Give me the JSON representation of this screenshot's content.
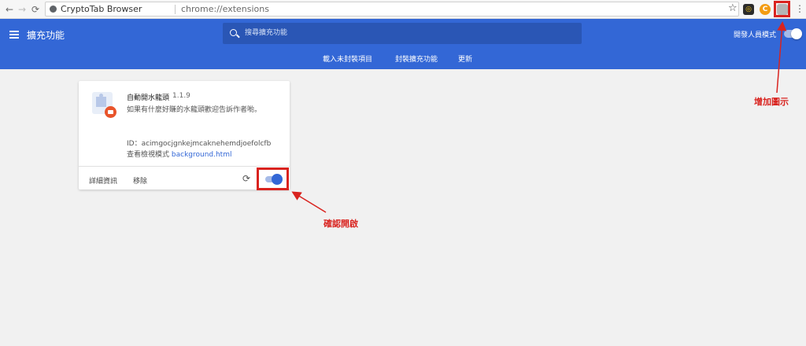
{
  "browser": {
    "site_name": "CryptoTab Browser",
    "url": "chrome://extensions",
    "back_glyph": "←",
    "forward_glyph": "→",
    "reload_glyph": "⟳",
    "star_glyph": "☆",
    "more_glyph": "⋮",
    "toolbar_icons": [
      {
        "name": "crypto-extension-icon",
        "glyph": "◎",
        "color": "#2b2b2b"
      },
      {
        "name": "cryptotab-icon",
        "glyph": "C",
        "color": "#f39c12"
      },
      {
        "name": "new-extension-icon",
        "glyph": "",
        "color": "#b5b5b5"
      }
    ]
  },
  "header": {
    "title": "擴充功能",
    "search_placeholder": "搜尋擴充功能",
    "dev_mode_label": "開發人員模式",
    "accent": "#3367d6",
    "tabs": [
      "載入未封裝項目",
      "封裝擴充功能",
      "更新"
    ]
  },
  "extension": {
    "name": "自動開水龍頭",
    "version": "1.1.9",
    "description": "如果有什麼好賺的水龍頭歡迎告訴作者喲。",
    "id_text": "ID：acimgocjgnkejmcaknehemdjoefolcfb",
    "inspect_label": "查看檢視模式",
    "inspect_link": "background.html",
    "details_label": "詳細資訊",
    "remove_label": "移除",
    "reload_glyph": "⟳",
    "enabled": true
  },
  "annotations": {
    "add_icon_note": "增加圖示",
    "confirm_enabled_note": "確認開啟",
    "color": "#d9231f"
  }
}
